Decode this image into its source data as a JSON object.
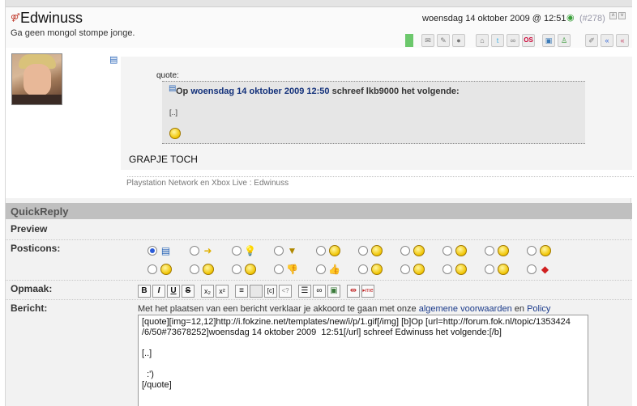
{
  "post": {
    "username": "Edwinuss",
    "user_title": "Ga geen mongol stompe jonge.",
    "date": "woensdag 14 oktober 2009 @ 12:51",
    "post_number": "(#278)",
    "quote_label": "quote:",
    "quote_prefix": "Op",
    "quote_date": "woensdag 14 oktober 2009 12:50",
    "quote_suffix": "schreef lkb9000 het volgende:",
    "quote_ellipsis": "[..]",
    "text": "GRAPJE TOCH",
    "signature": "Playstation Network en Xbox Live : Edwinuss"
  },
  "header_icons": [
    "mail-icon",
    "pm-icon",
    "circle-icon",
    "home-icon",
    "twitter-icon",
    "link-icon",
    "os-icon",
    "photo-icon",
    "user-icon",
    "edit-icon",
    "quote-icon",
    "quote-icon"
  ],
  "quickreply": {
    "title": "QuickReply",
    "preview_label": "Preview",
    "posticons_label": "Posticons:",
    "opmaak_label": "Opmaak:",
    "bericht_label": "Bericht:",
    "terms_text": "Met het plaatsen van een bericht verklaar je akkoord te gaan met onze",
    "terms_link": "algemene voorwaarden",
    "terms_and": "en",
    "policy_link": "Policy",
    "message": "[quote][img=12,12]http://i.fokzine.net/templates/new/i/p/1.gif[/img] [b]Op [url=http://forum.fok.nl/topic/1353424\n/6/50#73678252]woensdag 14 oktober 2009  12:51[/url] schreef Edwinuss het volgende:[/b]\n\n[..]\n\n  :')\n[/quote]"
  },
  "toolbar": {
    "bold": "B",
    "italic": "I",
    "underline": "U",
    "strike": "S",
    "sub": "x₂",
    "sup": "x²",
    "code": "[c]",
    "html": "<?"
  },
  "colors": {
    "accent": "#1a3a8a",
    "qr_header": "#c0c0c0"
  }
}
